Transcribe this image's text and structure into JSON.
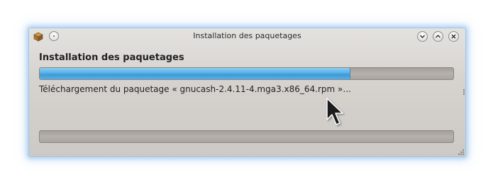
{
  "window": {
    "title": "Installation des paquetages"
  },
  "main": {
    "heading": "Installation des paquetages",
    "status": "Téléchargement du paquetage « gnucash-2.4.11-4.mga3.x86_64.rpm »...",
    "download_progress": 0.75,
    "overall_progress": 0.0
  },
  "icons": {
    "app": "package-icon",
    "menu": "window-menu-icon",
    "minimize": "chevron-down-icon",
    "maximize": "chevron-up-icon",
    "close": "close-icon",
    "cursor": "mouse-pointer-icon"
  },
  "colors": {
    "progress_fill": "#4aa6e0",
    "progress_track": "#aea8a4",
    "window_glow": "#8cbeeb"
  }
}
